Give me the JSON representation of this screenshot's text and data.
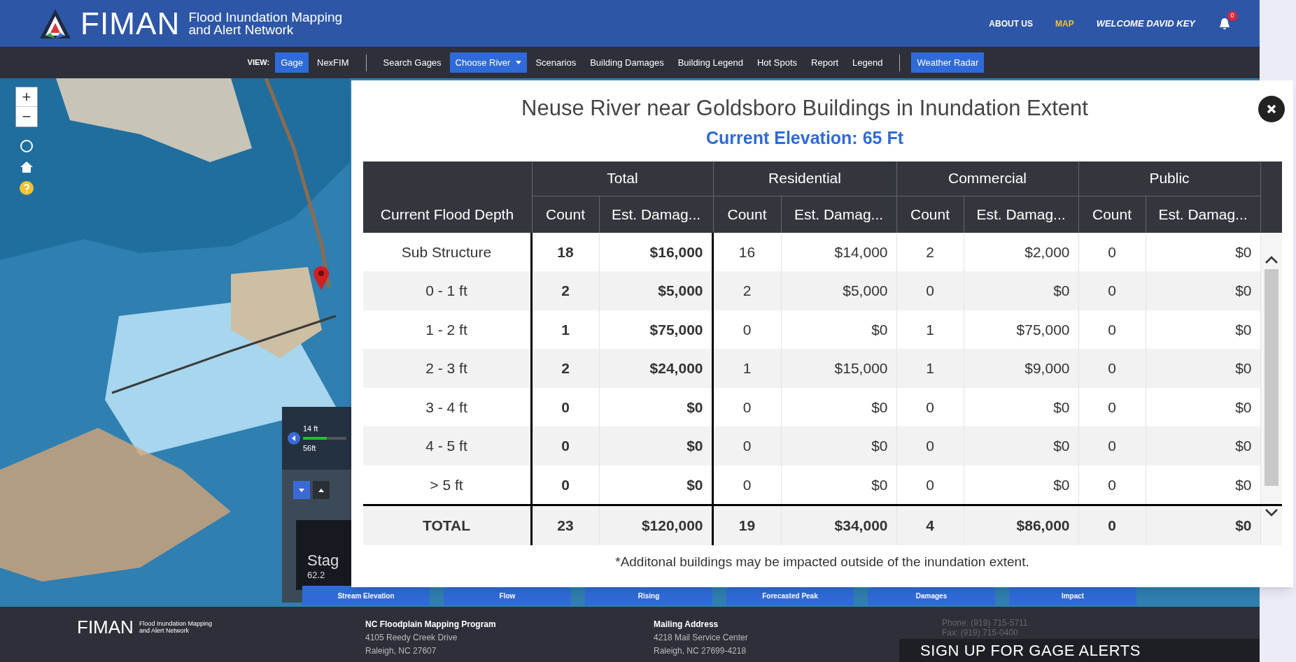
{
  "header": {
    "logo": "FIMAN",
    "tagline": [
      "Flood Inundation Mapping",
      "and Alert Network"
    ],
    "links": [
      {
        "label": "ABOUT US",
        "selected": false
      },
      {
        "label": "MAP",
        "selected": true
      }
    ],
    "welcome": "WELCOME DAVID KEY",
    "notification_count": "0"
  },
  "toolbar": {
    "view_label": "VIEW:",
    "view_options": [
      {
        "label": "Gage",
        "selected": true
      },
      {
        "label": "NexFIM",
        "selected": false
      }
    ],
    "items": [
      {
        "label": "Search Gages",
        "selected": false,
        "dropdown": false
      },
      {
        "label": "Choose River",
        "selected": true,
        "dropdown": true
      },
      {
        "label": "Scenarios",
        "selected": false,
        "dropdown": false
      },
      {
        "label": "Building Damages",
        "selected": false,
        "dropdown": false
      },
      {
        "label": "Building Legend",
        "selected": false,
        "dropdown": false
      },
      {
        "label": "Hot Spots",
        "selected": false,
        "dropdown": false
      },
      {
        "label": "Report",
        "selected": false,
        "dropdown": false
      },
      {
        "label": "Legend",
        "selected": false,
        "dropdown": false
      }
    ],
    "radar": {
      "label": "Weather Radar",
      "selected": true
    }
  },
  "map": {
    "zoom_in": "+",
    "zoom_out": "−",
    "stage_widget": {
      "top_reading": "14 ft",
      "bottom_reading": "56ft",
      "level": 0.55,
      "title": "Stag",
      "value": "62.2"
    },
    "bottom_buttons": [
      "Stream Elevation",
      "Flow",
      "Rising",
      "Forecasted Peak",
      "Damages",
      "Impact"
    ]
  },
  "modal": {
    "title": "Neuse River near Goldsboro Buildings in Inundation Extent",
    "subtitle": "Current Elevation: 65 Ft",
    "table": {
      "group_columns": [
        {
          "label": "Total",
          "sub_columns": [
            "Count",
            "Est. Damag..."
          ]
        },
        {
          "label": "Residential",
          "sub_columns": [
            "Count",
            "Est. Damag..."
          ]
        },
        {
          "label": "Commercial",
          "sub_columns": [
            "Count",
            "Est. Damag..."
          ]
        },
        {
          "label": "Public",
          "sub_columns": [
            "Count",
            "Est. Damag..."
          ]
        }
      ],
      "first_column": "Current Flood Depth",
      "rows": [
        [
          "Sub Structure",
          "18",
          "$16,000",
          "16",
          "$14,000",
          "2",
          "$2,000",
          "0",
          "$0"
        ],
        [
          "0 - 1 ft",
          "2",
          "$5,000",
          "2",
          "$5,000",
          "0",
          "$0",
          "0",
          "$0"
        ],
        [
          "1 - 2 ft",
          "1",
          "$75,000",
          "0",
          "$0",
          "1",
          "$75,000",
          "0",
          "$0"
        ],
        [
          "2 - 3 ft",
          "2",
          "$24,000",
          "1",
          "$15,000",
          "1",
          "$9,000",
          "0",
          "$0"
        ],
        [
          "3 - 4 ft",
          "0",
          "$0",
          "0",
          "$0",
          "0",
          "$0",
          "0",
          "$0"
        ],
        [
          "4 - 5 ft",
          "0",
          "$0",
          "0",
          "$0",
          "0",
          "$0",
          "0",
          "$0"
        ],
        [
          "> 5 ft",
          "0",
          "$0",
          "0",
          "$0",
          "0",
          "$0",
          "0",
          "$0"
        ]
      ],
      "total_row": [
        "TOTAL",
        "23",
        "$120,000",
        "19",
        "$34,000",
        "4",
        "$86,000",
        "0",
        "$0"
      ]
    },
    "note": "*Additonal buildings may be impacted outside of the inundation extent."
  },
  "footer": {
    "logo": "FIMAN",
    "tagline": [
      "Flood Inundation Mapping",
      "and Alert Network"
    ],
    "columns": [
      [
        "NC Floodplain Mapping Program",
        "4105 Reedy Creek Drive",
        "Raleigh, NC 27607"
      ],
      [
        "Mailing Address",
        "4218 Mail Service Center",
        "Raleigh, NC 27699-4218"
      ]
    ],
    "contact": [
      "Phone: (919) 715-5711",
      "Fax: (919) 715-0400"
    ],
    "signup": "SIGN UP FOR GAGE ALERTS"
  }
}
